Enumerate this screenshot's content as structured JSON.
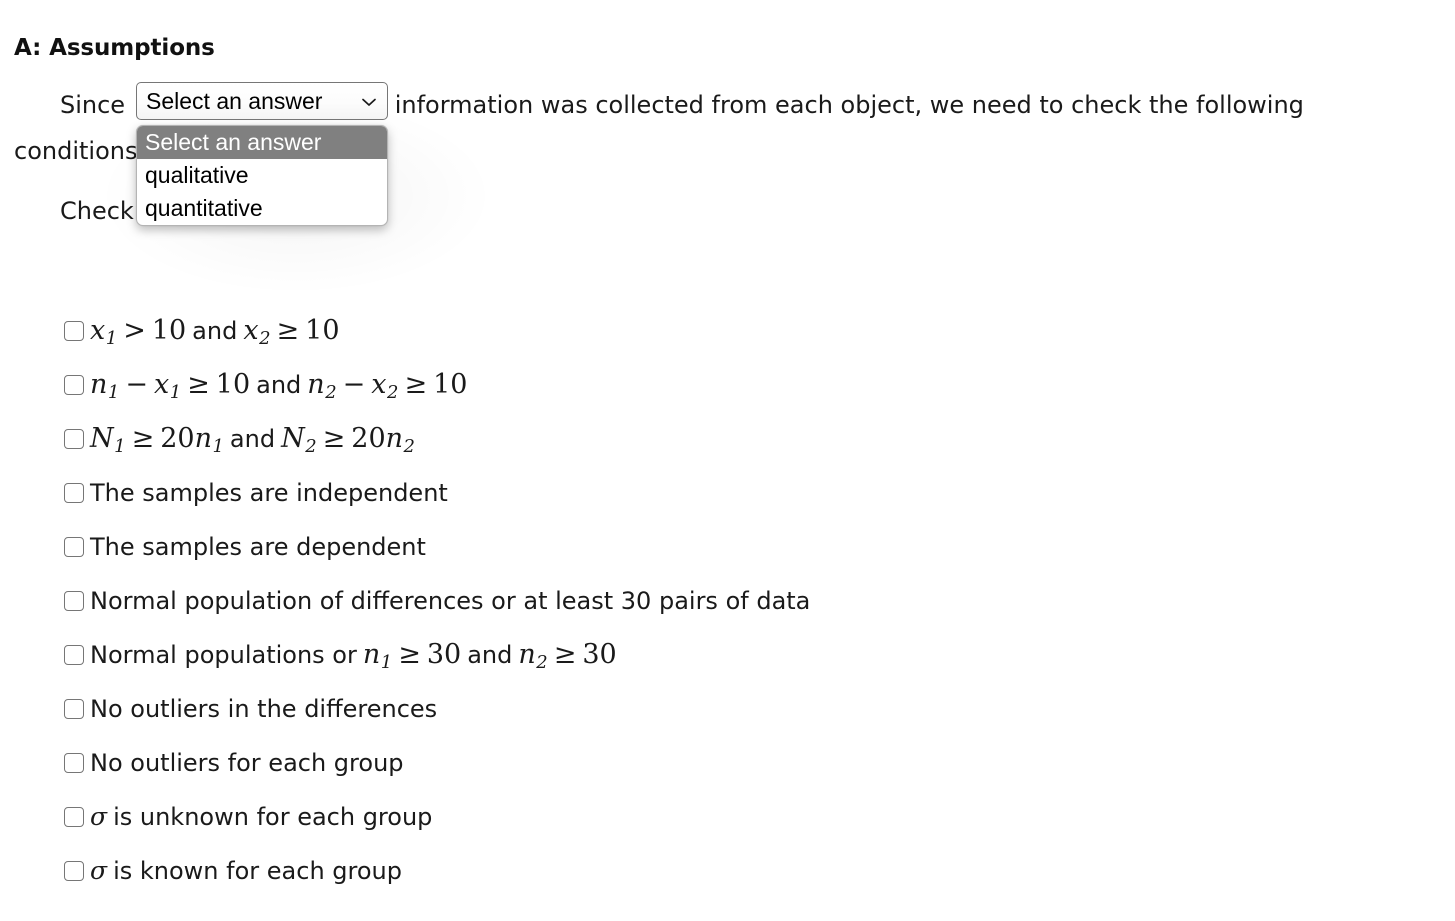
{
  "section": {
    "title": "A: Assumptions"
  },
  "paragraph": {
    "before_select": "Since",
    "after_select": "information was collected from each object, we need to check the following",
    "line2": "conditions.",
    "check_line": "Check all that apply."
  },
  "select": {
    "name": "data-type-select",
    "value": "Select an answer",
    "arrow_icon": "chevron-down-icon",
    "expanded": true,
    "options": [
      {
        "label": "Select an answer",
        "selected": true
      },
      {
        "label": "qualitative",
        "selected": false
      },
      {
        "label": "quantitative",
        "selected": false
      }
    ]
  },
  "assumptions": {
    "checked_any": false,
    "items": [
      {
        "id": "x1-gt-10",
        "checked": false,
        "plain_text": "x1 > 10 and x2 ≥ 10",
        "parts": [
          {
            "t": "var",
            "v": "x",
            "sub": "1"
          },
          {
            "t": "op",
            "v": ">"
          },
          {
            "t": "num",
            "v": "10"
          },
          {
            "t": "text",
            "v": "and"
          },
          {
            "t": "var",
            "v": "x",
            "sub": "2"
          },
          {
            "t": "op",
            "v": "≥"
          },
          {
            "t": "num",
            "v": "10"
          }
        ]
      },
      {
        "id": "n1-minus-x1",
        "checked": false,
        "plain_text": "n1 − x1 ≥ 10 and n2 − x2 ≥ 10",
        "parts": [
          {
            "t": "var",
            "v": "n",
            "sub": "1"
          },
          {
            "t": "op",
            "v": "−"
          },
          {
            "t": "var",
            "v": "x",
            "sub": "1"
          },
          {
            "t": "op",
            "v": "≥"
          },
          {
            "t": "num",
            "v": "10"
          },
          {
            "t": "text",
            "v": "and"
          },
          {
            "t": "var",
            "v": "n",
            "sub": "2"
          },
          {
            "t": "op",
            "v": "−"
          },
          {
            "t": "var",
            "v": "x",
            "sub": "2"
          },
          {
            "t": "op",
            "v": "≥"
          },
          {
            "t": "num",
            "v": "10"
          }
        ]
      },
      {
        "id": "N1-ge-20n1",
        "checked": false,
        "plain_text": "N1 ≥ 20n1 and N2 ≥ 20n2",
        "parts": [
          {
            "t": "var",
            "v": "N",
            "sub": "1"
          },
          {
            "t": "op",
            "v": "≥"
          },
          {
            "t": "num",
            "v": "20"
          },
          {
            "t": "var",
            "v": "n",
            "sub": "1",
            "tight": true
          },
          {
            "t": "text",
            "v": "and"
          },
          {
            "t": "var",
            "v": "N",
            "sub": "2"
          },
          {
            "t": "op",
            "v": "≥"
          },
          {
            "t": "num",
            "v": "20"
          },
          {
            "t": "var",
            "v": "n",
            "sub": "2",
            "tight": true
          }
        ]
      },
      {
        "id": "samples-independent",
        "checked": false,
        "plain_text": "The samples are independent",
        "parts": [
          {
            "t": "text",
            "v": "The samples are independent"
          }
        ]
      },
      {
        "id": "samples-dependent",
        "checked": false,
        "plain_text": "The samples are dependent",
        "parts": [
          {
            "t": "text",
            "v": "The samples are dependent"
          }
        ]
      },
      {
        "id": "normal-population-differences",
        "checked": false,
        "plain_text": "Normal population of differences or at least 30 pairs of data",
        "parts": [
          {
            "t": "text",
            "v": "Normal population of differences or at least 30 pairs of data"
          }
        ]
      },
      {
        "id": "normal-populations-n30",
        "checked": false,
        "plain_text": "Normal populations or n1 ≥ 30 and n2 ≥ 30",
        "parts": [
          {
            "t": "text",
            "v": "Normal populations or"
          },
          {
            "t": "var",
            "v": "n",
            "sub": "1"
          },
          {
            "t": "op",
            "v": "≥"
          },
          {
            "t": "num",
            "v": "30"
          },
          {
            "t": "text",
            "v": "and"
          },
          {
            "t": "var",
            "v": "n",
            "sub": "2"
          },
          {
            "t": "op",
            "v": "≥"
          },
          {
            "t": "num",
            "v": "30"
          }
        ]
      },
      {
        "id": "no-outliers-differences",
        "checked": false,
        "plain_text": "No outliers in the differences",
        "parts": [
          {
            "t": "text",
            "v": "No outliers in the differences"
          }
        ]
      },
      {
        "id": "no-outliers-each-group",
        "checked": false,
        "plain_text": "No outliers for each group",
        "parts": [
          {
            "t": "text",
            "v": "No outliers for each group"
          }
        ]
      },
      {
        "id": "sigma-unknown",
        "checked": false,
        "plain_text": "σ is unknown for each group",
        "parts": [
          {
            "t": "sigma",
            "v": "σ"
          },
          {
            "t": "text",
            "v": "is unknown for each group"
          }
        ]
      },
      {
        "id": "sigma-known",
        "checked": false,
        "plain_text": "σ is known for each group",
        "parts": [
          {
            "t": "sigma",
            "v": "σ"
          },
          {
            "t": "text",
            "v": "is known for each group"
          }
        ]
      }
    ]
  },
  "colors": {
    "page_background": "#ffffff",
    "text": "#1a1a1a",
    "select_border": "#767676",
    "popup_highlight": "#808080",
    "popup_highlight_text": "#ffffff",
    "checkbox_border": "#767676"
  }
}
